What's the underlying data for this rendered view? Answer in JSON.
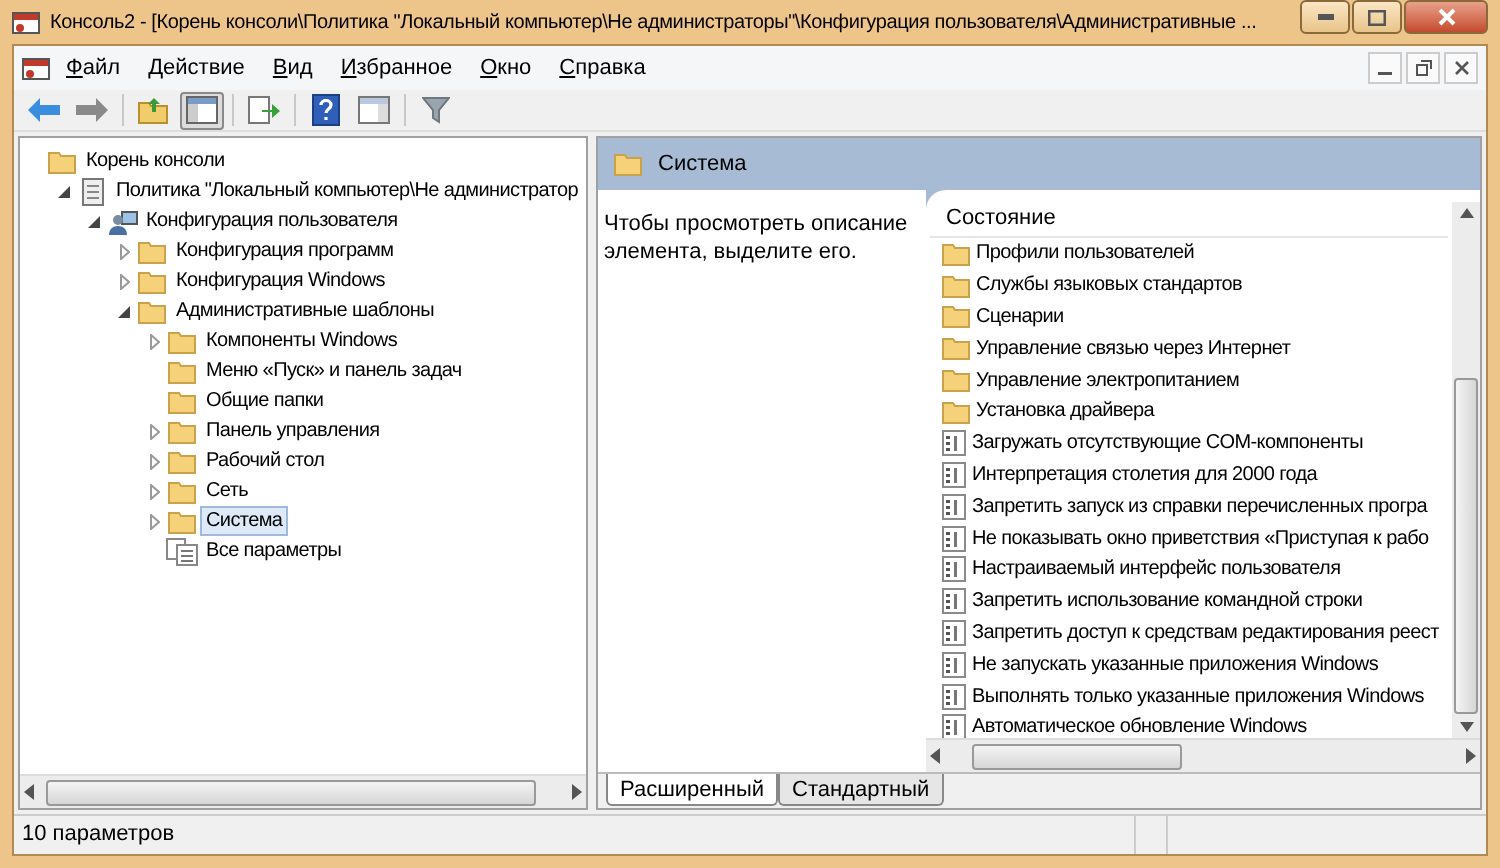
{
  "window": {
    "title": "Консоль2 - [Корень консоли\\Политика \"Локальный компьютер\\Не администраторы\"\\Конфигурация пользователя\\Административные ..."
  },
  "menu": [
    "Файл",
    "Действие",
    "Вид",
    "Избранное",
    "Окно",
    "Справка"
  ],
  "toolbar": [
    {
      "kind": "back",
      "pressed": false
    },
    {
      "kind": "forward",
      "pressed": false
    },
    {
      "kind": "sep"
    },
    {
      "kind": "up",
      "pressed": false
    },
    {
      "kind": "tree",
      "pressed": true
    },
    {
      "kind": "sep"
    },
    {
      "kind": "export",
      "pressed": false
    },
    {
      "kind": "sep"
    },
    {
      "kind": "help",
      "pressed": false
    },
    {
      "kind": "panel",
      "pressed": false
    },
    {
      "kind": "sep"
    },
    {
      "kind": "filter",
      "pressed": false
    }
  ],
  "tree": [
    {
      "label": "Корень консоли",
      "kind": "folder",
      "selected": false,
      "children": [
        {
          "label": "Политика \"Локальный компьютер\\Не администратор",
          "kind": "policy",
          "selected": false,
          "expanded": true,
          "children": [
            {
              "label": "Конфигурация пользователя",
              "kind": "user",
              "selected": false,
              "expanded": true,
              "children": [
                {
                  "label": "Конфигурация программ",
                  "kind": "folder",
                  "selected": false,
                  "expanded": false
                },
                {
                  "label": "Конфигурация Windows",
                  "kind": "folder",
                  "selected": false,
                  "expanded": false
                },
                {
                  "label": "Административные шаблоны",
                  "kind": "folder",
                  "selected": false,
                  "expanded": true,
                  "children": [
                    {
                      "label": "Компоненты Windows",
                      "kind": "folder",
                      "selected": false,
                      "expanded": false
                    },
                    {
                      "label": "Меню «Пуск» и панель задач",
                      "kind": "folder",
                      "selected": false
                    },
                    {
                      "label": "Общие папки",
                      "kind": "folder",
                      "selected": false
                    },
                    {
                      "label": "Панель управления",
                      "kind": "folder",
                      "selected": false,
                      "expanded": false
                    },
                    {
                      "label": "Рабочий стол",
                      "kind": "folder",
                      "selected": false,
                      "expanded": false
                    },
                    {
                      "label": "Сеть",
                      "kind": "folder",
                      "selected": false,
                      "expanded": false
                    },
                    {
                      "label": "Система",
                      "kind": "folder",
                      "selected": true,
                      "expanded": false
                    },
                    {
                      "label": "Все параметры",
                      "kind": "settings",
                      "selected": false
                    }
                  ]
                }
              ]
            }
          ]
        }
      ]
    }
  ],
  "detail": {
    "title": "Система",
    "description": "Чтобы просмотреть описание элемента, выделите его.",
    "column": "Состояние",
    "items": [
      {
        "label": "Профили пользователей",
        "kind": "folder"
      },
      {
        "label": "Службы языковых стандартов",
        "kind": "folder"
      },
      {
        "label": "Сценарии",
        "kind": "folder"
      },
      {
        "label": "Управление связью через Интернет",
        "kind": "folder"
      },
      {
        "label": "Управление электропитанием",
        "kind": "folder"
      },
      {
        "label": "Установка драйвера",
        "kind": "folder"
      },
      {
        "label": "Загружать отсутствующие COM-компоненты",
        "kind": "setting"
      },
      {
        "label": "Интерпретация столетия для 2000 года",
        "kind": "setting"
      },
      {
        "label": "Запретить запуск из справки перечисленных програ",
        "kind": "setting"
      },
      {
        "label": "Не показывать окно приветствия «Приступая к рабо",
        "kind": "setting"
      },
      {
        "label": "Настраиваемый интерфейс пользователя",
        "kind": "setting"
      },
      {
        "label": "Запретить использование командной строки",
        "kind": "setting"
      },
      {
        "label": "Запретить доступ к средствам редактирования реест",
        "kind": "setting"
      },
      {
        "label": "Не запускать указанные приложения Windows",
        "kind": "setting"
      },
      {
        "label": "Выполнять только указанные приложения Windows",
        "kind": "setting"
      },
      {
        "label": "Автоматическое обновление Windows",
        "kind": "setting"
      }
    ],
    "tabs": [
      {
        "label": "Расширенный",
        "selected": true
      },
      {
        "label": "Стандартный",
        "selected": false
      }
    ]
  },
  "status_bar": "10 параметров"
}
